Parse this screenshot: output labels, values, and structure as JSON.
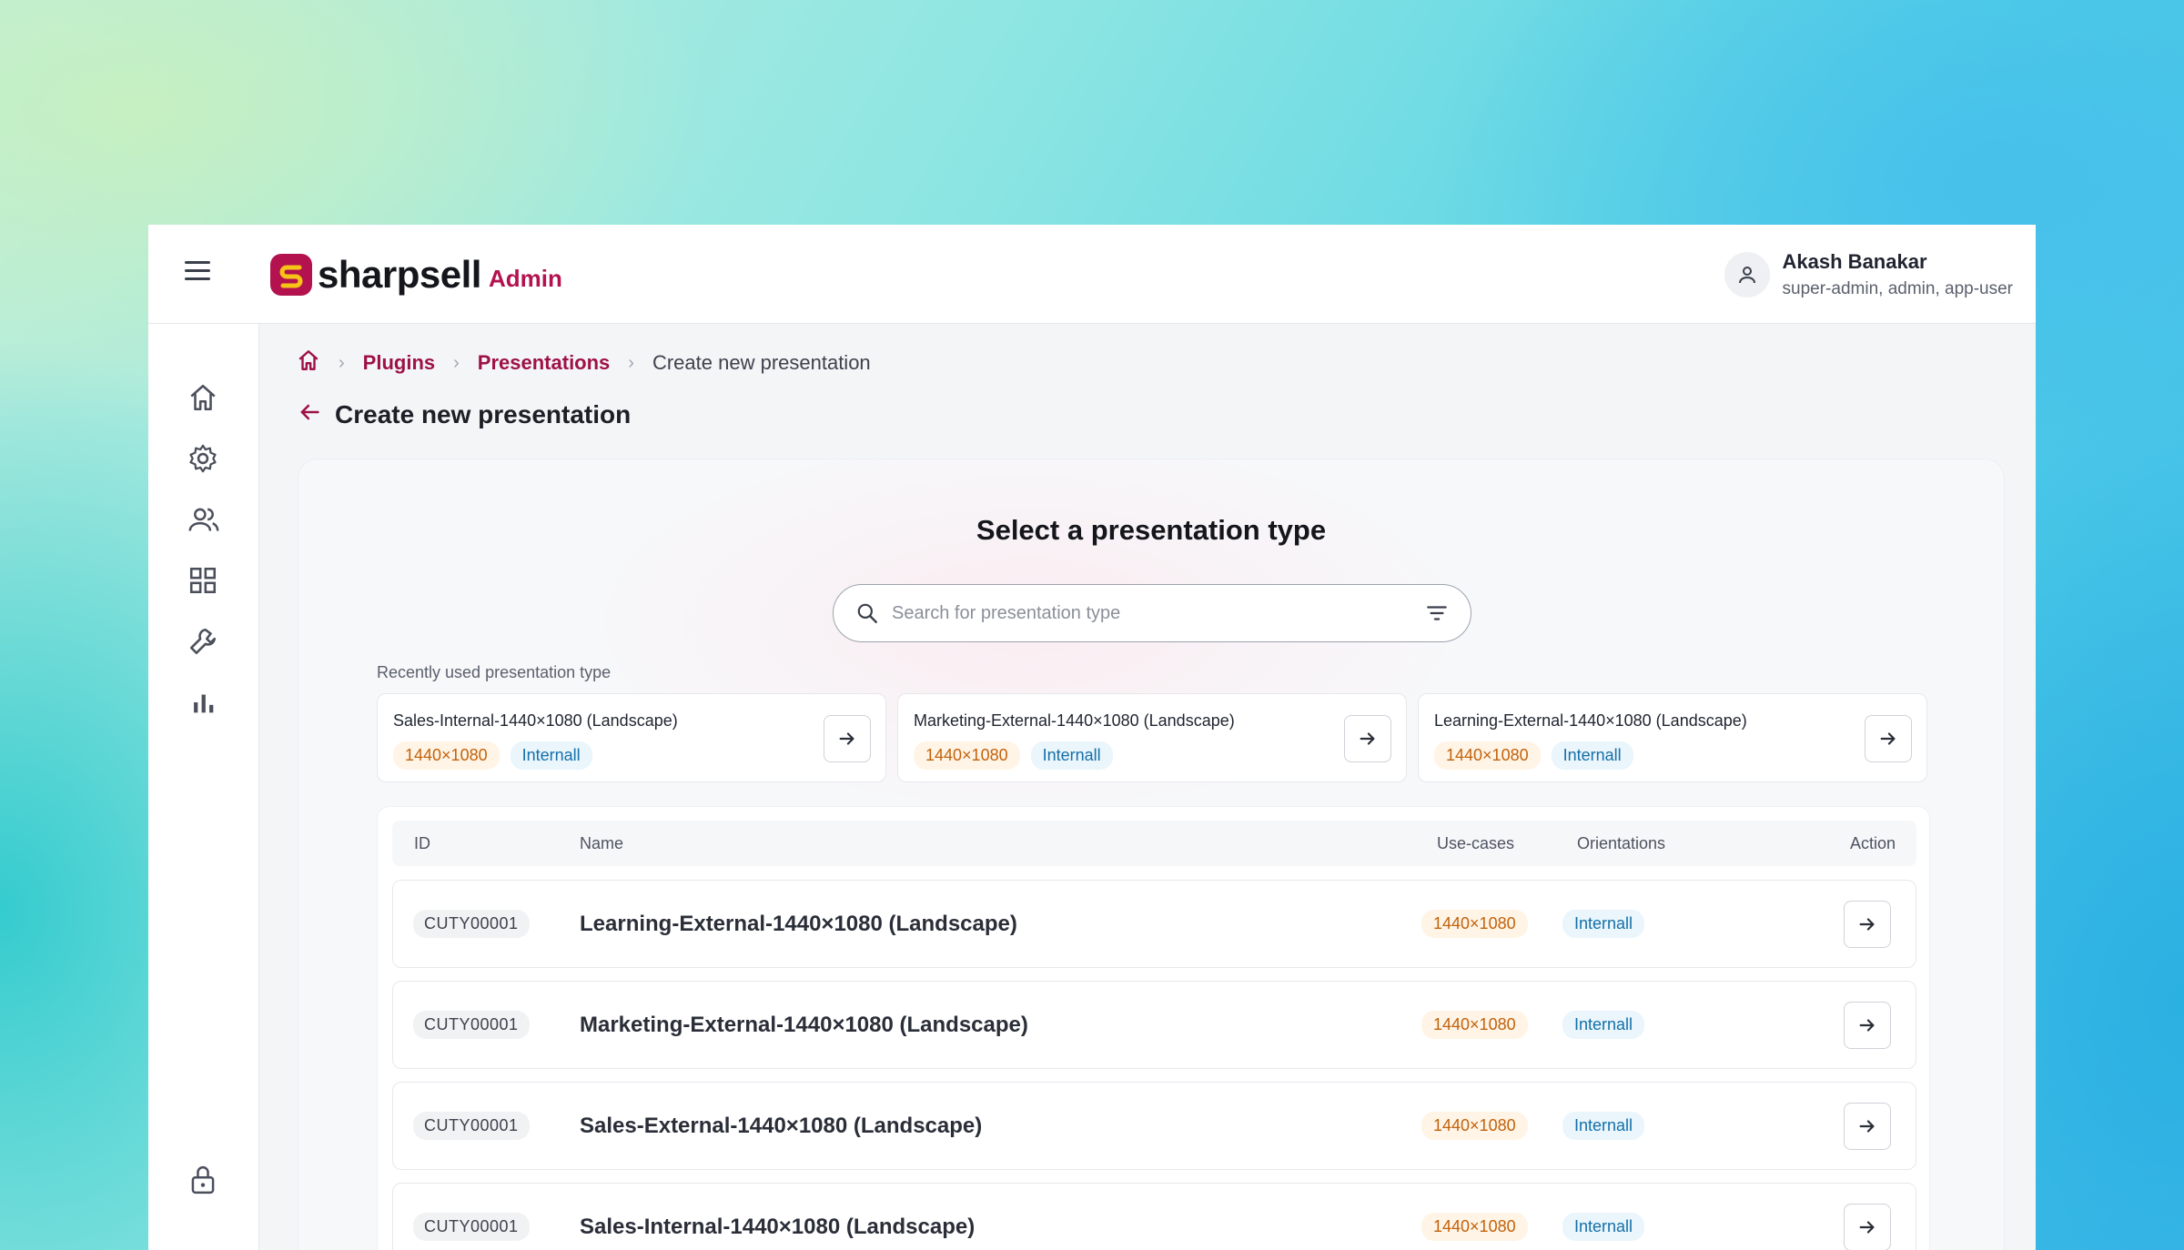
{
  "brand": {
    "name": "sharpsell",
    "sub": "Admin",
    "color": "#b3124e"
  },
  "user": {
    "name": "Akash Banakar",
    "roles": "super-admin, admin, app-user"
  },
  "sidebar": {
    "items": [
      {
        "icon": "home-icon"
      },
      {
        "icon": "gear-icon"
      },
      {
        "icon": "users-icon"
      },
      {
        "icon": "grid-icon"
      },
      {
        "icon": "wrench-icon"
      },
      {
        "icon": "bar-chart-icon"
      },
      {
        "icon": "lock-icon"
      }
    ]
  },
  "breadcrumb": {
    "items": [
      "Plugins",
      "Presentations"
    ],
    "current": "Create new presentation"
  },
  "page": {
    "title": "Create new presentation"
  },
  "selector": {
    "heading": "Select a presentation type",
    "search_placeholder": "Search for presentation type",
    "recent_label": "Recently used presentation type",
    "recent": [
      {
        "title": "Sales-Internal-1440×1080 (Landscape)",
        "size": "1440×1080",
        "tag": "Internall"
      },
      {
        "title": "Marketing-External-1440×1080 (Landscape)",
        "size": "1440×1080",
        "tag": "Internall"
      },
      {
        "title": "Learning-External-1440×1080 (Landscape)",
        "size": "1440×1080",
        "tag": "Internall"
      }
    ]
  },
  "table": {
    "columns": [
      "ID",
      "Name",
      "Use-cases",
      "Orientations",
      "Action"
    ],
    "rows": [
      {
        "id": "CUTY00001",
        "name": "Learning-External-1440×1080 (Landscape)",
        "use_case": "1440×1080",
        "orientation": "Internall"
      },
      {
        "id": "CUTY00001",
        "name": "Marketing-External-1440×1080 (Landscape)",
        "use_case": "1440×1080",
        "orientation": "Internall"
      },
      {
        "id": "CUTY00001",
        "name": "Sales-External-1440×1080 (Landscape)",
        "use_case": "1440×1080",
        "orientation": "Internall"
      },
      {
        "id": "CUTY00001",
        "name": "Sales-Internal-1440×1080 (Landscape)",
        "use_case": "1440×1080",
        "orientation": "Internall"
      }
    ]
  }
}
